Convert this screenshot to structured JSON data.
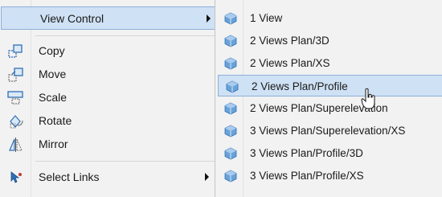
{
  "main_menu": {
    "items": [
      {
        "label": "View Control",
        "has_submenu": true,
        "icon": "none"
      },
      {
        "label": "Copy",
        "icon": "copy-icon"
      },
      {
        "label": "Move",
        "icon": "move-icon"
      },
      {
        "label": "Scale",
        "icon": "scale-icon"
      },
      {
        "label": "Rotate",
        "icon": "rotate-icon"
      },
      {
        "label": "Mirror",
        "icon": "mirror-icon"
      },
      {
        "label": "Select Links",
        "has_submenu": true,
        "icon": "select-links-icon"
      }
    ],
    "highlight_color": "#cfe1f4"
  },
  "submenu": {
    "items": [
      {
        "label": "1 View"
      },
      {
        "label": "2 Views Plan/3D"
      },
      {
        "label": "2 Views Plan/XS"
      },
      {
        "label": "2 Views Plan/Profile"
      },
      {
        "label": "2 Views Plan/Superelevation"
      },
      {
        "label": "3 Views Plan/Superelevation/XS"
      },
      {
        "label": "3 Views Plan/Profile/3D"
      },
      {
        "label": "3 Views Plan/Profile/XS"
      }
    ],
    "icon": "view-cube-icon",
    "hovered_item": "2 Views Plan/Profile"
  }
}
